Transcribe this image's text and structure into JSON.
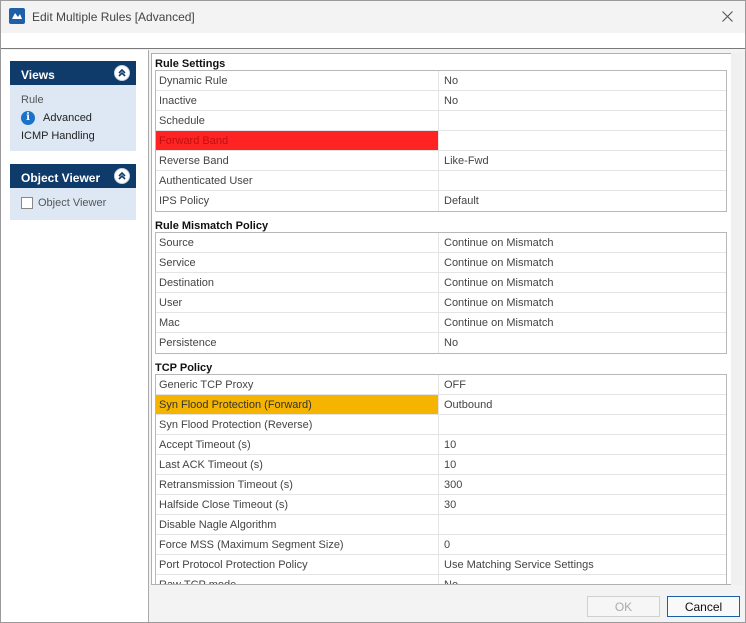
{
  "window": {
    "title": "Edit Multiple Rules [Advanced]"
  },
  "views": {
    "header": "Views",
    "items": [
      "Rule",
      "Advanced",
      "ICMP Handling"
    ]
  },
  "object_viewer": {
    "header": "Object Viewer",
    "checkbox_label": "Object Viewer"
  },
  "rule_settings": {
    "title": "Rule Settings",
    "rows": [
      {
        "name": "Dynamic Rule",
        "value": "No"
      },
      {
        "name": "Inactive",
        "value": "No"
      },
      {
        "name": "Schedule",
        "value": ""
      },
      {
        "name": "Forward Band",
        "value": ""
      },
      {
        "name": "Reverse Band",
        "value": "Like-Fwd"
      },
      {
        "name": "Authenticated User",
        "value": ""
      },
      {
        "name": "IPS Policy",
        "value": "Default"
      }
    ]
  },
  "mismatch_policy": {
    "title": "Rule Mismatch Policy",
    "rows": [
      {
        "name": "Source",
        "value": "Continue on Mismatch"
      },
      {
        "name": "Service",
        "value": "Continue on Mismatch"
      },
      {
        "name": "Destination",
        "value": "Continue on Mismatch"
      },
      {
        "name": "User",
        "value": "Continue on Mismatch"
      },
      {
        "name": "Mac",
        "value": "Continue on Mismatch"
      },
      {
        "name": "Persistence",
        "value": "No"
      }
    ]
  },
  "tcp_policy": {
    "title": "TCP Policy",
    "rows": [
      {
        "name": "Generic TCP Proxy",
        "value": "OFF"
      },
      {
        "name": "Syn Flood Protection (Forward)",
        "value": "Outbound"
      },
      {
        "name": "Syn Flood Protection (Reverse)",
        "value": ""
      },
      {
        "name": "Accept Timeout (s)",
        "value": "10"
      },
      {
        "name": "Last ACK Timeout (s)",
        "value": "10"
      },
      {
        "name": "Retransmission Timeout (s)",
        "value": "300"
      },
      {
        "name": "Halfside Close Timeout (s)",
        "value": "30"
      },
      {
        "name": "Disable Nagle Algorithm",
        "value": ""
      },
      {
        "name": "Force MSS (Maximum Segment Size)",
        "value": "0"
      },
      {
        "name": "Port Protocol Protection Policy",
        "value": "Use Matching Service Settings"
      },
      {
        "name": "Raw TCP mode",
        "value": "No"
      }
    ]
  },
  "buttons": {
    "ok": "OK",
    "cancel": "Cancel"
  },
  "colors": {
    "header_bg": "#0f3b6b",
    "highlight_red": "#ff2323",
    "highlight_orange": "#f5b400",
    "info_blue": "#1a73c9"
  }
}
